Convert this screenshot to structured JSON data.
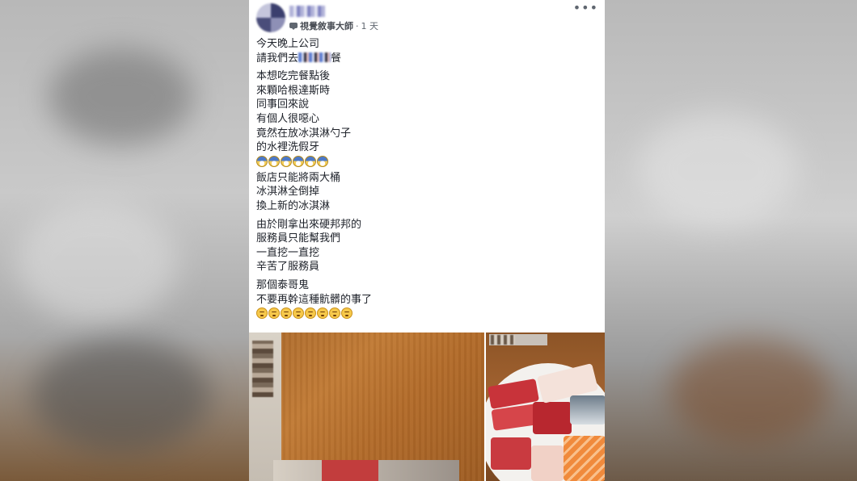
{
  "post": {
    "group_name": "視覺敘事大師",
    "separator": "·",
    "timestamp": "1 天",
    "more_label": "•••",
    "paragraphs": [
      {
        "lines": [
          "今天晚上公司",
          "請我們去",
          "餐"
        ]
      },
      {
        "lines": [
          "本想吃完餐點後",
          "來顆哈根達斯時",
          "同事回來說",
          "有個人很噁心",
          "竟然在放冰淇淋勺子",
          "的水裡洗假牙"
        ]
      },
      {
        "lines": [
          "飯店只能將兩大桶",
          "冰淇淋全倒掉",
          "換上新的冰淇淋"
        ]
      },
      {
        "lines": [
          "由於剛拿出來硬邦邦的",
          "服務員只能幫我們",
          "一直挖一直挖",
          "辛苦了服務員"
        ]
      },
      {
        "lines": [
          "那個泰哥鬼",
          "不要再幹這種骯髒的事了"
        ]
      }
    ],
    "emoji_scream": [
      "scream-emoji",
      "scream-emoji",
      "scream-emoji",
      "scream-emoji",
      "scream-emoji",
      "scream-emoji"
    ],
    "emoji_angry": [
      "angry-emoji",
      "angry-emoji",
      "angry-emoji",
      "angry-emoji",
      "angry-emoji",
      "angry-emoji",
      "angry-emoji",
      "angry-emoji"
    ]
  },
  "colors": {
    "text": "#1d2129",
    "meta": "#606770",
    "card_bg": "#ffffff"
  }
}
